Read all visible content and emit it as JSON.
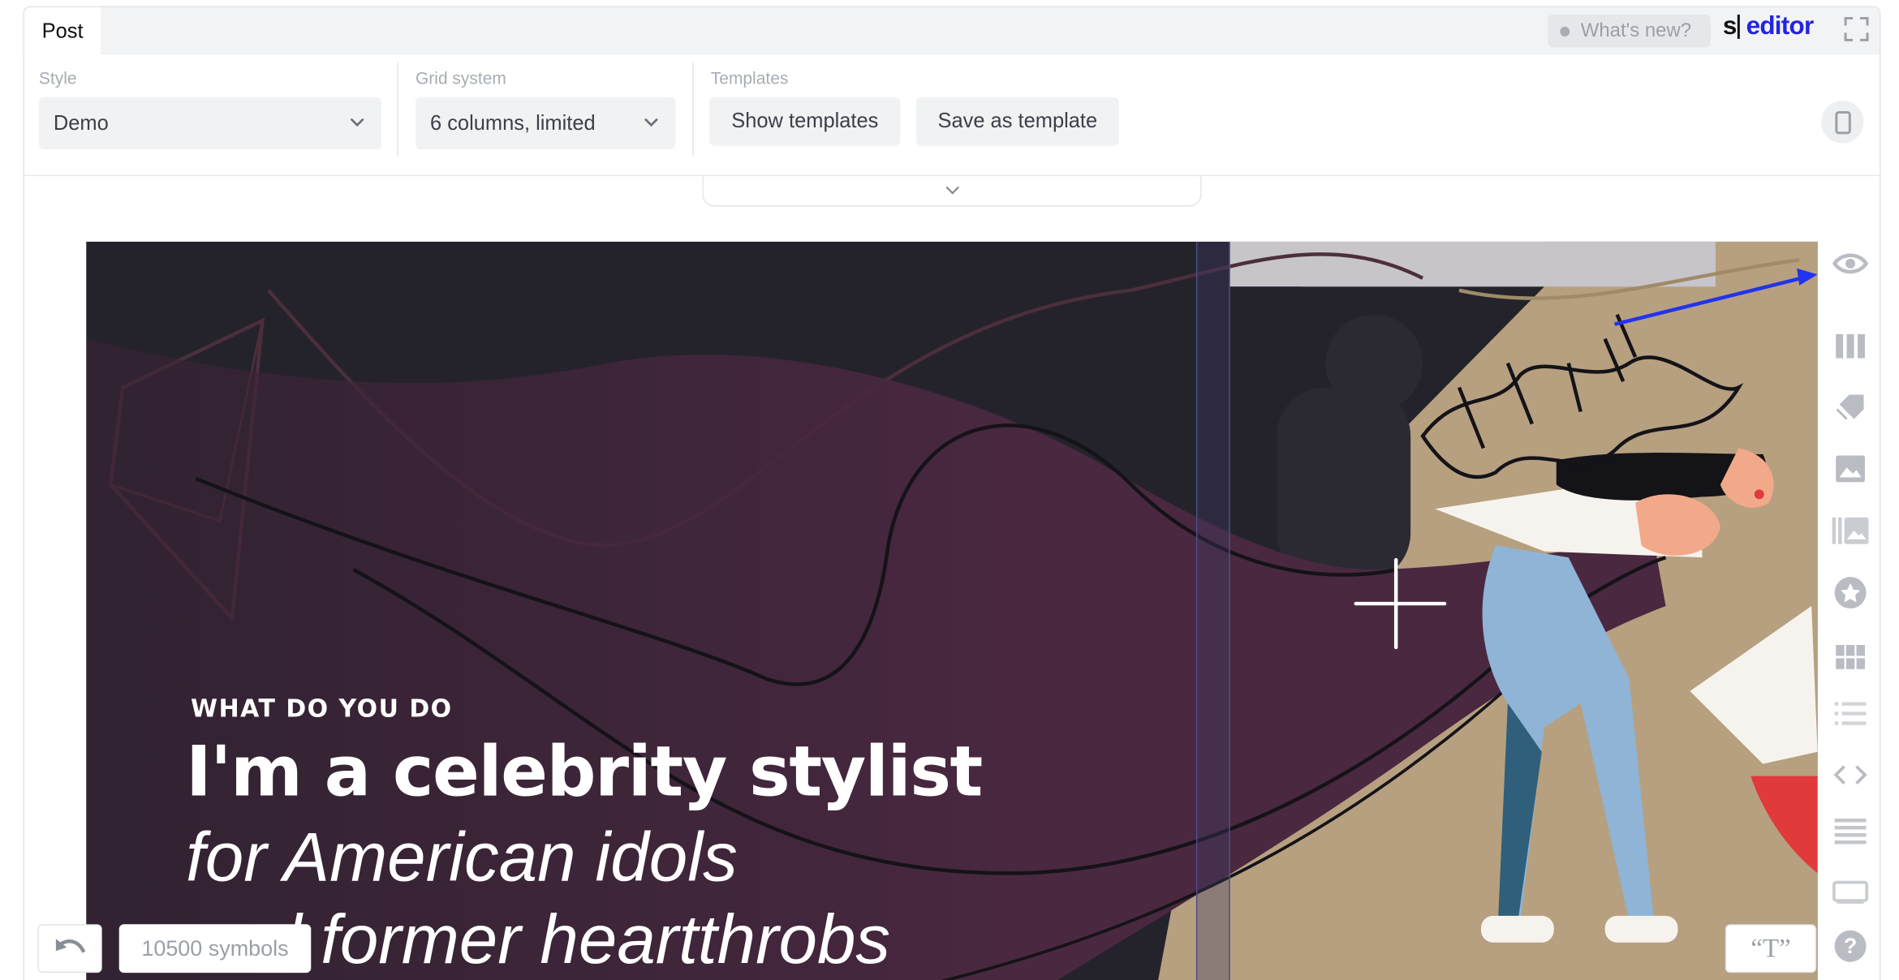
{
  "header": {
    "tab_label": "Post",
    "whats_new": "What's new?",
    "logo_s": "s",
    "logo_editor": "editor"
  },
  "toolbar": {
    "style_label": "Style",
    "style_value": "Demo",
    "grid_label": "Grid system",
    "grid_value": "6 columns, limited",
    "templates_label": "Templates",
    "show_templates": "Show templates",
    "save_template": "Save as template"
  },
  "hero": {
    "overline": "WHAT DO YOU DO",
    "headline": "I'm a celebrity stylist",
    "subline1": "for American idols",
    "subline2": "and former heartthrobs"
  },
  "rail": {
    "icons": [
      "eye-icon",
      "columns-icon",
      "tags-icon",
      "image-icon",
      "gallery-icon",
      "star-icon",
      "grid-icon",
      "list-icon",
      "code-icon",
      "lines-icon",
      "frame-icon",
      "help-icon"
    ]
  },
  "footer": {
    "symbols": "10500 symbols",
    "quote": "“T”"
  },
  "colors": {
    "accent": "#2424e0",
    "hero_dark": "#23222c",
    "hero_purple": "#4a2840",
    "hero_sand": "#b6a07f"
  }
}
